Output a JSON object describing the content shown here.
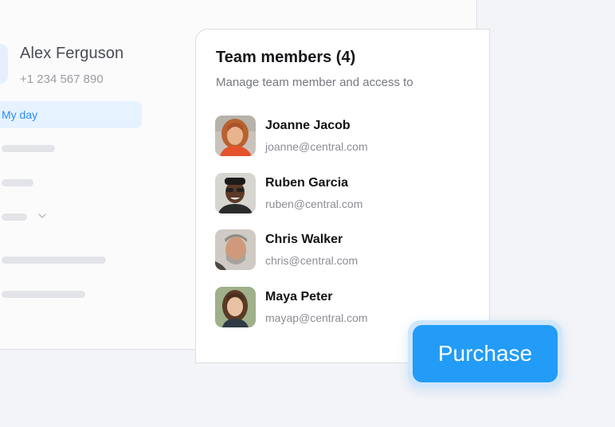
{
  "profile": {
    "name": "Alex Ferguson",
    "phone": "+1 234 567 890"
  },
  "sidebar": {
    "active_item": "My day"
  },
  "team": {
    "title": "Team members (4)",
    "subtitle": "Manage team member and access to",
    "members": [
      {
        "name": "Joanne Jacob",
        "email": "joanne@central.com"
      },
      {
        "name": "Ruben Garcia",
        "email": "ruben@central.com"
      },
      {
        "name": "Chris Walker",
        "email": "chris@central.com"
      },
      {
        "name": "Maya Peter",
        "email": "mayap@central.com"
      }
    ]
  },
  "actions": {
    "purchase_label": "Purchase"
  },
  "colors": {
    "accent": "#229cf7",
    "active_nav_bg": "#e6f2ff",
    "active_nav_text": "#2a8cf0",
    "background": "#f3f4f7"
  }
}
